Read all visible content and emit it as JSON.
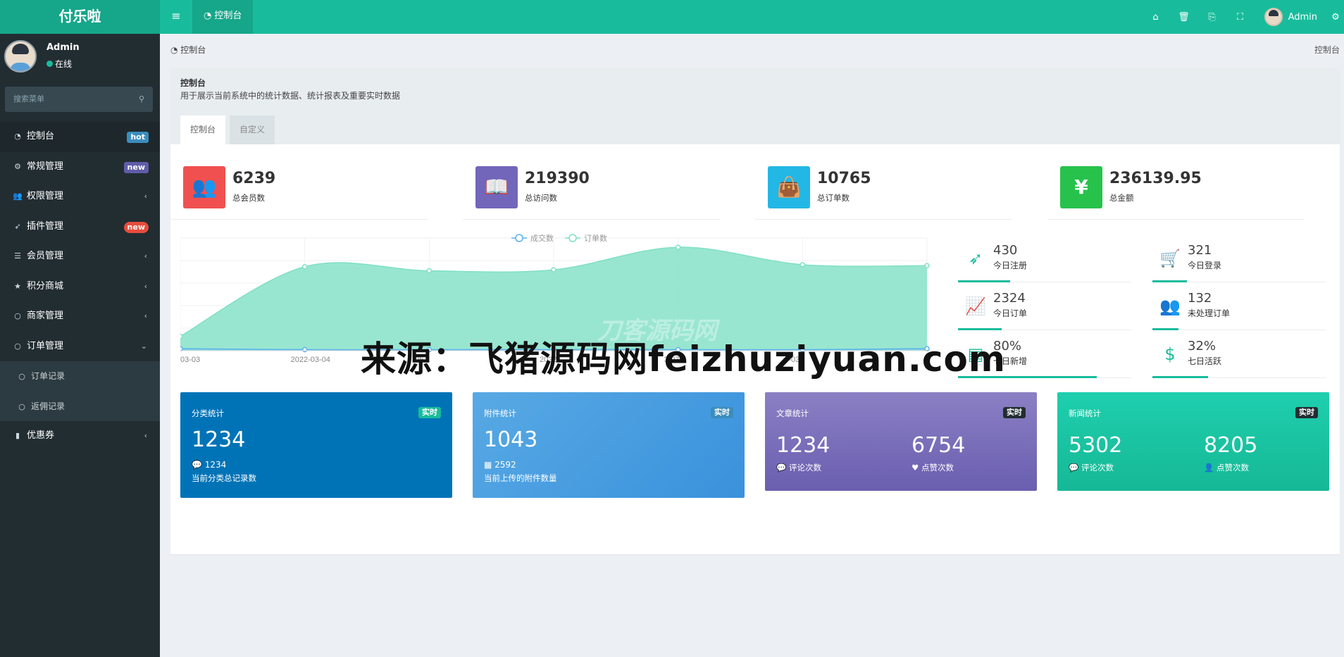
{
  "app": {
    "brand": "付乐啦"
  },
  "topbar": {
    "tab_label": "控制台",
    "user_name": "Admin"
  },
  "sidebar": {
    "user": {
      "name": "Admin",
      "status": "在线"
    },
    "search_placeholder": "搜索菜单",
    "items": [
      {
        "label": "控制台",
        "badge": "hot",
        "badge_color": "#3c8dbc",
        "icon": "dashboard-icon"
      },
      {
        "label": "常规管理",
        "badge": "new",
        "badge_color": "#605ca8",
        "icon": "cogs-icon"
      },
      {
        "label": "权限管理",
        "icon": "users-icon"
      },
      {
        "label": "插件管理",
        "badge": "new",
        "badge_color": "#e74c3c",
        "icon": "rocket-icon"
      },
      {
        "label": "会员管理",
        "icon": "list-icon"
      },
      {
        "label": "积分商城",
        "icon": "star-icon"
      },
      {
        "label": "商家管理",
        "icon": "circle-icon"
      },
      {
        "label": "订单管理",
        "icon": "circle-icon"
      },
      {
        "label": "订单记录",
        "icon": "circle-icon"
      },
      {
        "label": "返佣记录",
        "icon": "circle-icon"
      },
      {
        "label": "优惠券",
        "icon": "bookmark-icon"
      }
    ]
  },
  "breadcrumb": {
    "label": "控制台",
    "right": "控制台"
  },
  "panel": {
    "title": "控制台",
    "desc": "用于展示当前系统中的统计数据、统计报表及重要实时数据",
    "tabs": [
      "控制台",
      "自定义"
    ]
  },
  "stats": [
    {
      "value": "6239",
      "label": "总会员数",
      "color": "#f05050",
      "icon": "users-icon"
    },
    {
      "value": "219390",
      "label": "总访问数",
      "color": "#7266ba",
      "icon": "book-icon"
    },
    {
      "value": "10765",
      "label": "总订单数",
      "color": "#23b7e5",
      "icon": "shopping-bag-icon"
    },
    {
      "value": "236139.95",
      "label": "总金额",
      "color": "#27c24c",
      "icon": "yen-icon"
    }
  ],
  "mini_stats": [
    {
      "value": "430",
      "label": "今日注册",
      "icon": "rocket-icon",
      "progress": 0.3
    },
    {
      "value": "321",
      "label": "今日登录",
      "icon": "cart-icon",
      "progress": 0.2
    },
    {
      "value": "2324",
      "label": "今日订单",
      "icon": "line-chart-icon",
      "progress": 0.25
    },
    {
      "value": "132",
      "label": "未处理订单",
      "icon": "users-icon",
      "progress": 0.15
    },
    {
      "value": "80%",
      "label": "七日新增",
      "icon": "list-alt-icon",
      "progress": 0.8
    },
    {
      "value": "32%",
      "label": "七日活跃",
      "icon": "dollar-icon",
      "progress": 0.32
    }
  ],
  "cards": [
    {
      "title": "分类统计",
      "badge": "实时",
      "value": "1234",
      "sub_value": "1234",
      "sub_label": "当前分类总记录数",
      "color": "#0073b7",
      "badge_color": "#18bc9c"
    },
    {
      "title": "附件统计",
      "badge": "实时",
      "value": "1043",
      "sub_value": "2592",
      "sub_label": "当前上传的附件数量",
      "color": "#3c9ee0",
      "badge_color": "#3c8dbc"
    },
    {
      "title": "文章统计",
      "badge": "实时",
      "left_value": "1234",
      "left_label": "评论次数",
      "right_value": "6754",
      "right_label": "点赞次数",
      "color": "#7a6dba",
      "badge_color": "#222d32"
    },
    {
      "title": "新闻统计",
      "badge": "实时",
      "left_value": "5302",
      "left_label": "评论次数",
      "right_value": "8205",
      "right_label": "点赞次数",
      "color": "#18bc9c",
      "badge_color": "#222d32"
    }
  ],
  "chart_data": {
    "type": "area",
    "x": [
      "2022-03-03",
      "2022-03-04",
      "2022-03-05",
      "2022-03-06",
      "2022-03-07",
      "2022-03-08",
      "2022-03-09"
    ],
    "x_tick_labels": [
      "03-03",
      "2022-03-04",
      "05",
      "2022-",
      "3-07",
      "-03-"
    ],
    "series": [
      {
        "name": "成交数",
        "values": [
          2,
          1,
          1,
          1,
          1,
          1,
          2
        ],
        "color": "#5ab1ef"
      },
      {
        "name": "订单数",
        "values": [
          14,
          82,
          78,
          79,
          101,
          84,
          83
        ],
        "color": "#7fe0c4"
      }
    ],
    "ylim": [
      0,
      110
    ],
    "legend": "top-center",
    "grid": true
  },
  "watermark": {
    "text": "来源：飞猪源码网feizhuziyuan.com",
    "faint_text": "刀客源码网"
  }
}
